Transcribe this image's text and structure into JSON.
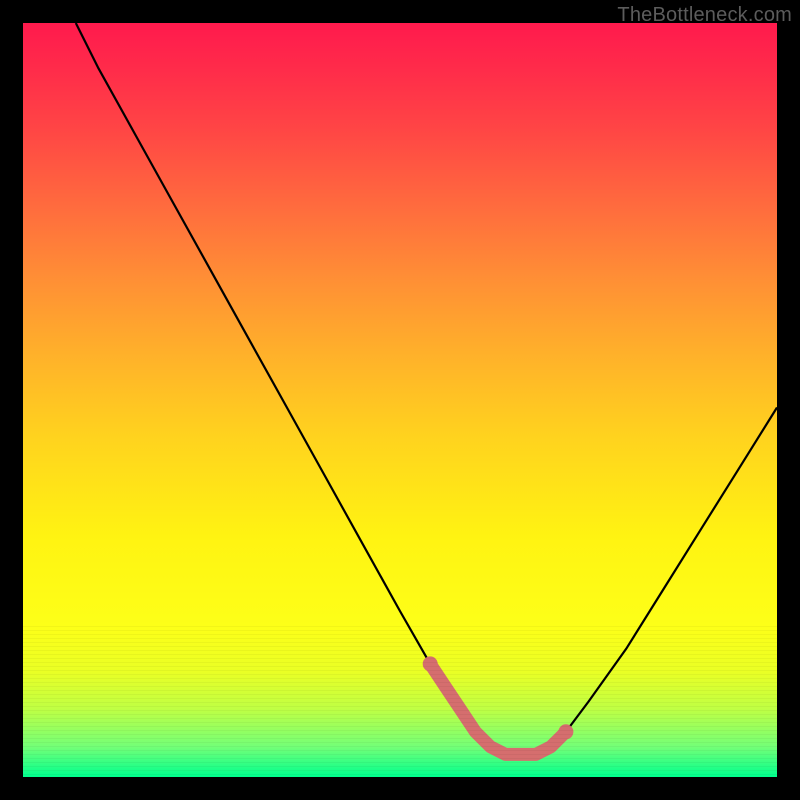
{
  "watermark": "TheBottleneck.com",
  "colors": {
    "background": "#000000",
    "curve": "#000000",
    "marker": "#d56e6e",
    "gradient_top": "#ff1a4d",
    "gradient_bottom": "#00ff8e"
  },
  "chart_data": {
    "type": "line",
    "title": "",
    "xlabel": "",
    "ylabel": "",
    "xlim": [
      0,
      100
    ],
    "ylim": [
      0,
      100
    ],
    "grid": false,
    "legend": false,
    "series": [
      {
        "name": "curve",
        "x": [
          7,
          10,
          15,
          20,
          25,
          30,
          35,
          40,
          45,
          50,
          54,
          56,
          58,
          60,
          62,
          64,
          66,
          68,
          70,
          72,
          75,
          80,
          85,
          90,
          95,
          100
        ],
        "values": [
          100,
          94,
          85,
          76,
          67,
          58,
          49,
          40,
          31,
          22,
          15,
          12,
          9,
          6,
          4,
          3,
          3,
          3,
          4,
          6,
          10,
          17,
          25,
          33,
          41,
          49
        ]
      },
      {
        "name": "highlight-band",
        "x": [
          54,
          56,
          58,
          60,
          62,
          64,
          66,
          68,
          70,
          72
        ],
        "values": [
          15,
          12,
          9,
          6,
          4,
          3,
          3,
          3,
          4,
          6
        ]
      }
    ],
    "annotations": []
  }
}
